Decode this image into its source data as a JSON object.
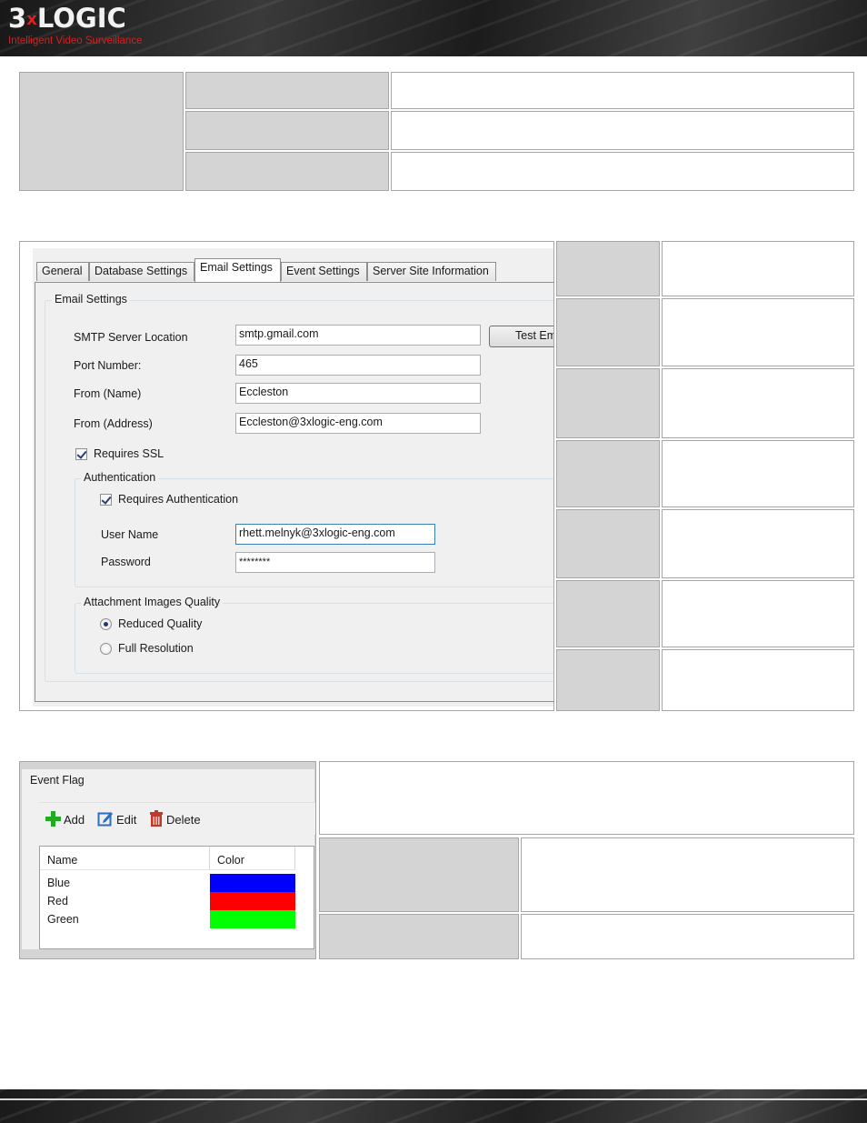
{
  "header": {
    "logo_text_a": "3",
    "logo_text_x": "x",
    "logo_text_b": "LOGIC",
    "tagline": "Intelligent Video Surveillance"
  },
  "email_dialog": {
    "tabs": [
      {
        "label": "General"
      },
      {
        "label": "Database Settings"
      },
      {
        "label": "Email Settings"
      },
      {
        "label": "Event Settings"
      },
      {
        "label": "Server Site Information"
      }
    ],
    "group_title": "Email Settings",
    "smtp_label": "SMTP Server Location",
    "smtp_value": "smtp.gmail.com",
    "test_button": "Test Email",
    "port_label": "Port Number:",
    "port_value": "465",
    "from_name_label": "From (Name)",
    "from_name_value": "Eccleston",
    "from_address_label": "From (Address)",
    "from_address_value": "Eccleston@3xlogic-eng.com",
    "requires_ssl_label": "Requires SSL",
    "requires_ssl_checked": true,
    "auth_group_title": "Authentication",
    "requires_auth_label": "Requires Authentication",
    "requires_auth_checked": true,
    "username_label": "User Name",
    "username_value": "rhett.melnyk@3xlogic-eng.com",
    "password_label": "Password",
    "password_value": "********",
    "quality_group_title": "Attachment Images Quality",
    "reduced_quality_label": "Reduced Quality",
    "full_resolution_label": "Full Resolution",
    "selected_quality": "Reduced Quality"
  },
  "event_flag": {
    "group_title": "Event Flag",
    "add_label": "Add",
    "edit_label": "Edit",
    "delete_label": "Delete",
    "columns": {
      "name": "Name",
      "color": "Color"
    },
    "rows": [
      {
        "name": "Blue",
        "color": "#0000ff"
      },
      {
        "name": "Red",
        "color": "#ff0000"
      },
      {
        "name": "Green",
        "color": "#00ff00"
      }
    ]
  },
  "colors": {
    "brand_red": "#e02020",
    "cell_gray": "#d4d4d4",
    "add_green": "#22aa22",
    "edit_blue": "#2b6cc4",
    "delete_red": "#c0392b"
  }
}
